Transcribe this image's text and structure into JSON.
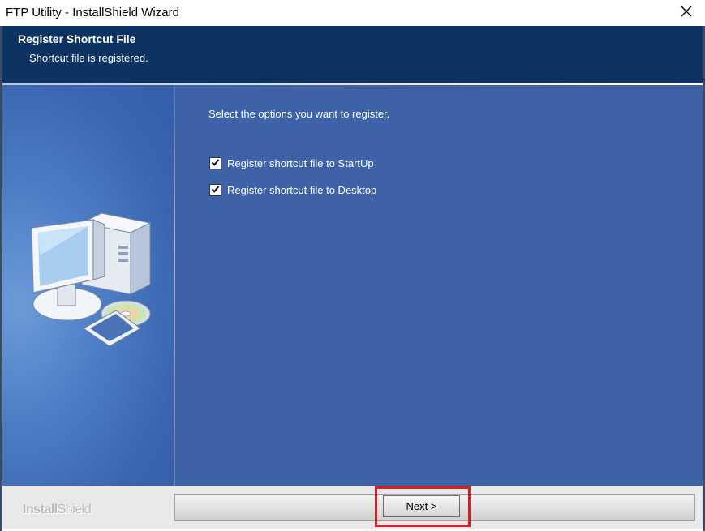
{
  "window": {
    "title": "FTP Utility - InstallShield Wizard",
    "close_icon": "close-icon"
  },
  "header": {
    "title": "Register Shortcut File",
    "subtitle": "Shortcut file is registered."
  },
  "content": {
    "prompt": "Select the options you want to register.",
    "options": [
      {
        "label": "Register shortcut file to StartUp",
        "checked": true
      },
      {
        "label": "Register shortcut file to Desktop",
        "checked": true
      }
    ]
  },
  "footer": {
    "brand_bold": "Install",
    "brand_light": "Shield",
    "next_label": "Next >"
  },
  "colors": {
    "header_bg": "#0d3363",
    "body_bg": "#3d62a8",
    "highlight": "#d42127"
  }
}
